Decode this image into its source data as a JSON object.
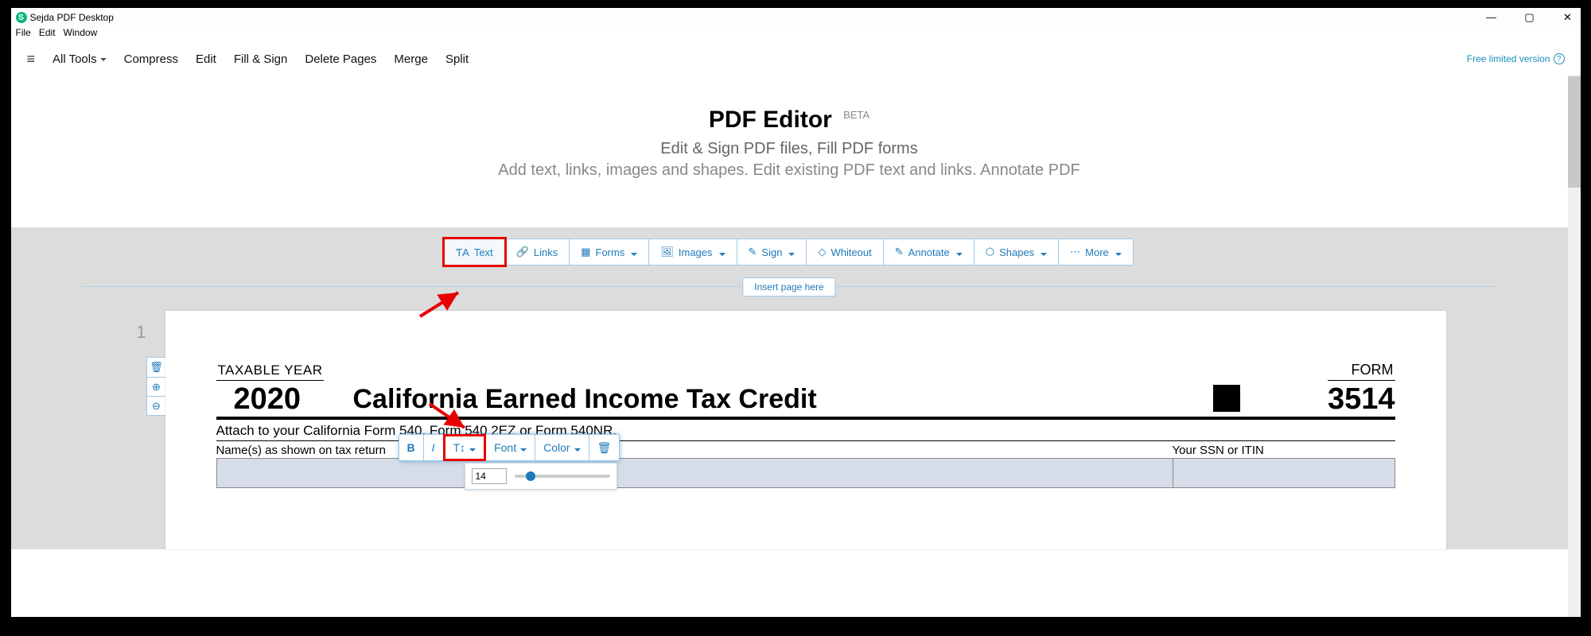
{
  "window": {
    "title": "Sejda PDF Desktop"
  },
  "menubar": {
    "file": "File",
    "edit": "Edit",
    "window": "Window"
  },
  "toolbar": {
    "all_tools": "All Tools",
    "compress": "Compress",
    "edit": "Edit",
    "fill_sign": "Fill & Sign",
    "delete_pages": "Delete Pages",
    "merge": "Merge",
    "split": "Split"
  },
  "free_note": "Free limited version",
  "hero": {
    "title": "PDF Editor",
    "badge": "BETA",
    "sub1": "Edit & Sign PDF files, Fill PDF forms",
    "sub2": "Add text, links, images and shapes. Edit existing PDF text and links. Annotate PDF"
  },
  "editor_tabs": {
    "text": "Text",
    "links": "Links",
    "forms": "Forms",
    "images": "Images",
    "sign": "Sign",
    "whiteout": "Whiteout",
    "annotate": "Annotate",
    "shapes": "Shapes",
    "more": "More"
  },
  "insert_page": "Insert page here",
  "page_number": "1",
  "text_toolbar": {
    "bold": "B",
    "italic": "I",
    "size": "T↕",
    "font": "Font",
    "color": "Color",
    "size_value": "14"
  },
  "document": {
    "taxable_year_label": "TAXABLE YEAR",
    "year": "2020",
    "title": "California Earned Income Tax Credit",
    "form_label": "FORM",
    "form_number": "3514",
    "attach_line": "Attach to your California Form 540, Form 540 2EZ or Form 540NR.",
    "names_label": "Name(s) as shown on tax return",
    "ssn_label": "Your SSN or ITIN"
  }
}
